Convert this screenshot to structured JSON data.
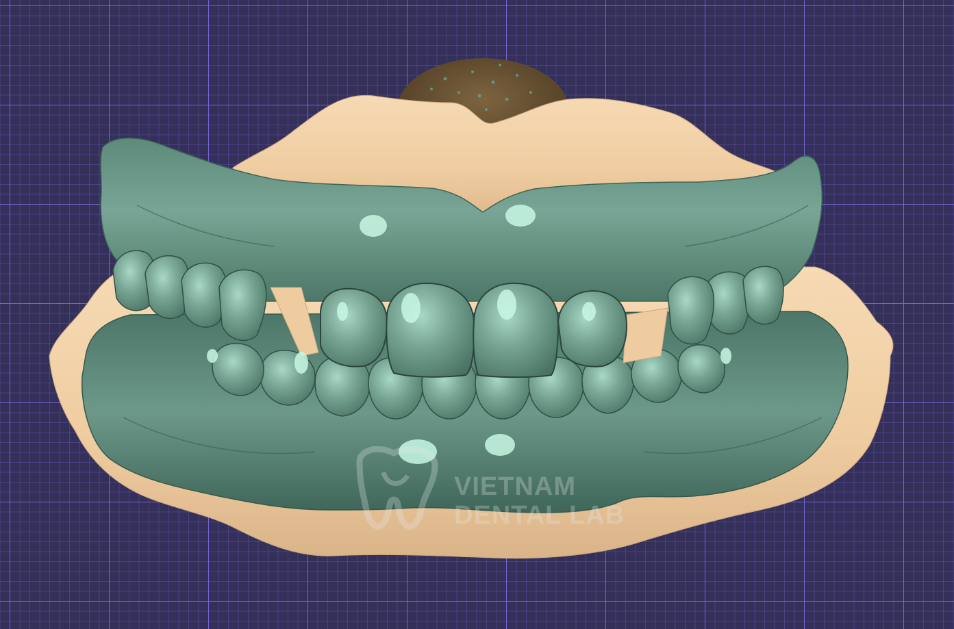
{
  "image": {
    "subject": "dental-model-3d-view",
    "colors": {
      "background": "#35305a",
      "grid_major": "#7d69e6",
      "grid_minor": "#6e5fc8",
      "stone": "#f1cfa5",
      "stone_shadow": "#c9a77e",
      "teeth": "#6f9a8a",
      "teeth_dark": "#3f6a5c",
      "teeth_highlight": "#bff3de",
      "tongue": "#6b5436"
    }
  },
  "watermark": {
    "line1": "VIETNAM",
    "line2": "DENTAL LAB"
  }
}
